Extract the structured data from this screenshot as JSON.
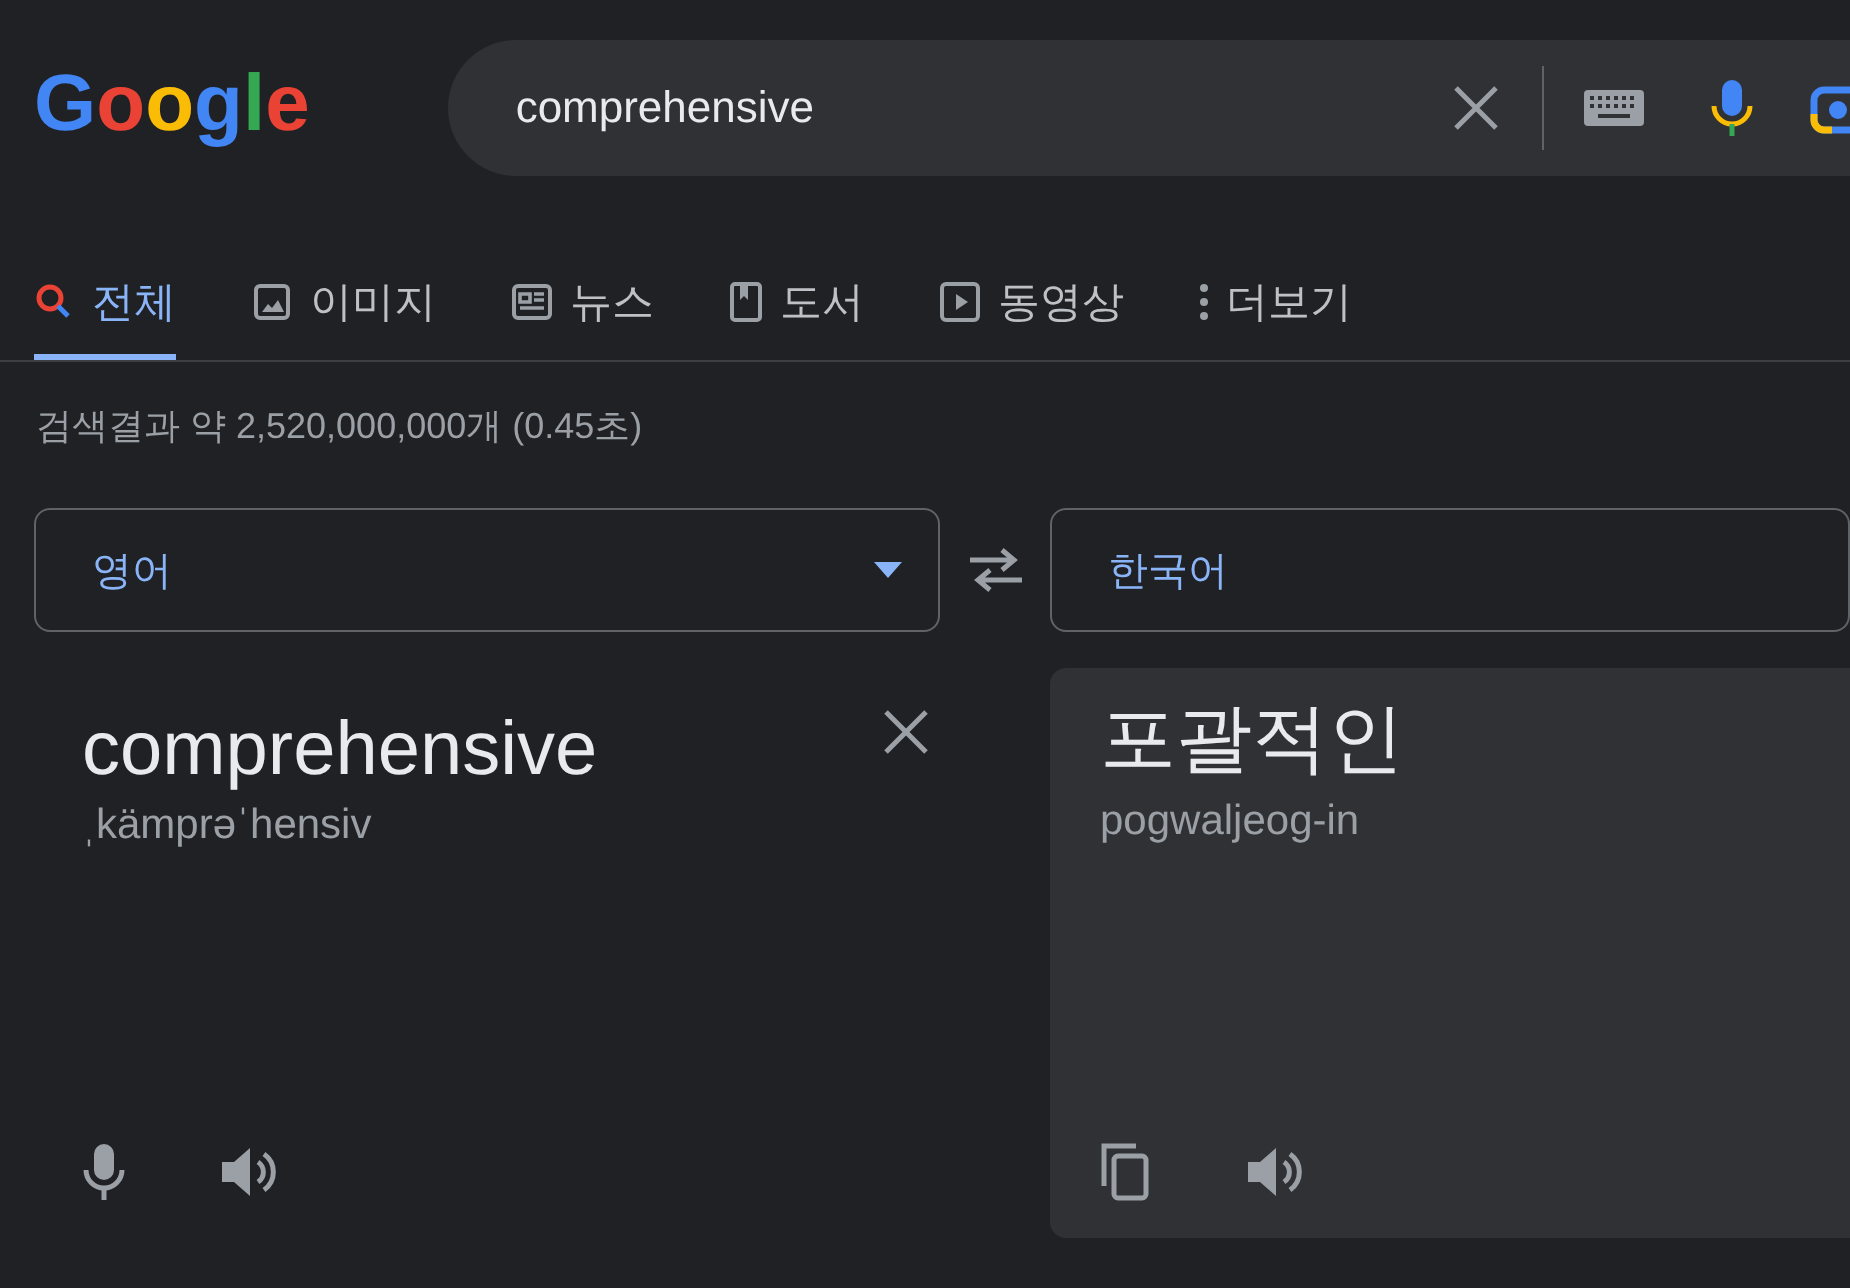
{
  "logo": {
    "text": "Google"
  },
  "search": {
    "value": "comprehensive"
  },
  "tabs": [
    {
      "label": "전체",
      "kind": "search",
      "selected": true
    },
    {
      "label": "이미지",
      "kind": "image",
      "selected": false
    },
    {
      "label": "뉴스",
      "kind": "news",
      "selected": false
    },
    {
      "label": "도서",
      "kind": "book",
      "selected": false
    },
    {
      "label": "동영상",
      "kind": "video",
      "selected": false
    },
    {
      "label": "더보기",
      "kind": "more",
      "selected": false
    }
  ],
  "result_stats": "검색결과 약 2,520,000,000개 (0.45초)",
  "translator": {
    "source_language": "영어",
    "target_language": "한국어",
    "source_text": "comprehensive",
    "source_phonetic": "ˌkämprəˈhensiv",
    "target_text": "포괄적인",
    "target_romanization": "pogwaljeog-in"
  }
}
